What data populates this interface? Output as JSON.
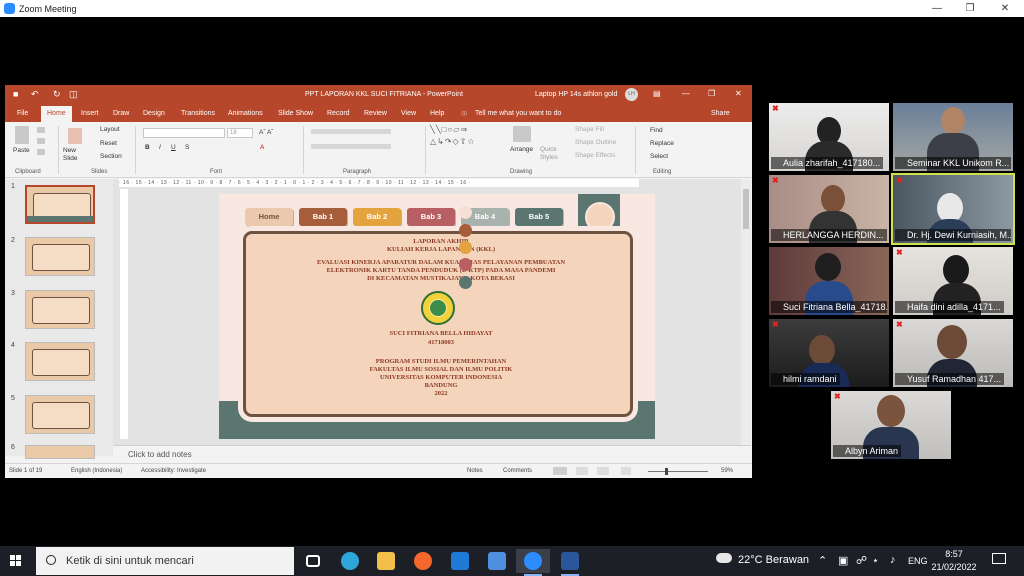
{
  "zoom": {
    "title": "Zoom Meeting"
  },
  "powerpoint": {
    "window_title": "PPT LAPORAN KKL SUCI FITRIANA  -  PowerPoint",
    "account": "Laptop HP 14s athlon gold",
    "avatar_initials": "LH",
    "tabs": [
      "File",
      "Home",
      "Insert",
      "Draw",
      "Design",
      "Transitions",
      "Animations",
      "Slide Show",
      "Record",
      "Review",
      "View",
      "Help"
    ],
    "active_tab": "Home",
    "tell_me": "Tell me what you want to do",
    "share": "Share",
    "ribbon": {
      "paste": "Paste",
      "new_slide": "New Slide",
      "layout": "Layout",
      "reset": "Reset",
      "section": "Section",
      "font_size": "18",
      "find": "Find",
      "replace": "Replace",
      "select": "Select",
      "arrange": "Arrange",
      "quick_styles": "Quick Styles",
      "shape_fill": "Shape Fill",
      "shape_outline": "Shape Outline",
      "shape_effects": "Shape Effects",
      "groups": [
        "Clipboard",
        "Slides",
        "Font",
        "Paragraph",
        "Drawing",
        "Editing"
      ]
    },
    "ruler": "· 16 · 15 · 14 · 13 · 12 · 11 · 10 · 9 · 8 · 7 · 6 · 5 · 4 · 3 · 2 · 1 · 0 · 1 · 2 · 3 · 4 · 5 · 6 · 7 · 8 · 9 · 10 · 11 · 12 · 13 · 14 · 15 · 16 ·",
    "thumbnails": [
      "1",
      "2",
      "3",
      "4",
      "5",
      "6"
    ],
    "notes_placeholder": "Click to add notes",
    "status": {
      "slide": "Slide 1 of 19",
      "language": "English (Indonesia)",
      "accessibility": "Accessibility: Investigate",
      "notes": "Notes",
      "comments": "Comments",
      "zoom": "59%"
    }
  },
  "slide": {
    "nav": [
      "Home",
      "Bab 1",
      "Bab 2",
      "Bab 3",
      "Bab 4",
      "Bab 5"
    ],
    "nav_colors": [
      "#ecc8ae",
      "#a65e3a",
      "#e3a33f",
      "#b85f63",
      "#a9b3ae",
      "#5b7570"
    ],
    "dot_colors": [
      "#f6ded3",
      "#a65e3a",
      "#e3a33f",
      "#b85f63",
      "#5b7570"
    ],
    "title1": "LAPORAN AKHIR",
    "title2": "KULIAH KERJA LAPANGAN (KKL)",
    "subtitle1": "EVALUASI KINERJA APARATUR DALAM KUALITIAS PELAYANAN PEMBUATAN",
    "subtitle2": "ELEKTRONIK KARTU TANDA PENDUDUK (E-KTP) PADA MASA PANDEMI",
    "subtitle3": "DI KECAMATAN MUSTIKAJAYA, KOTA BEKASI",
    "author": "SUCI FITRIANA BELLA HIDAYAT",
    "nim": "41718003",
    "program": "PROGRAM STUDI ILMU PEMERINTAHAN",
    "faculty": "FAKULTAS ILMU SOSIAL DAN ILMU POLITIK",
    "university": "UNIVERSITAS KOMPUTER INDONESIA",
    "city": "BANDUNG",
    "year": "2022"
  },
  "participants": [
    {
      "name": "Aulia zharifah_417180...",
      "muted": true
    },
    {
      "name": "Seminar KKL Unikom R...",
      "muted": false
    },
    {
      "name": "HERLANGGA HERDIN...",
      "muted": true
    },
    {
      "name": "Dr. Hj. Dewi Kurniasih, M...",
      "muted": true,
      "active": true
    },
    {
      "name": "Suci Fitriana Bella_41718...",
      "muted": false
    },
    {
      "name": "Haifa dini adilla_4171...",
      "muted": true
    },
    {
      "name": "hilmi ramdani",
      "muted": true
    },
    {
      "name": "Yusuf Ramadhan 417...",
      "muted": true
    },
    {
      "name": "Albyn Ariman",
      "muted": true
    }
  ],
  "taskbar": {
    "search_placeholder": "Ketik di sini untuk mencari",
    "weather": "22°C  Berawan",
    "lang": "ENG",
    "time": "8:57",
    "date": "21/02/2022"
  }
}
